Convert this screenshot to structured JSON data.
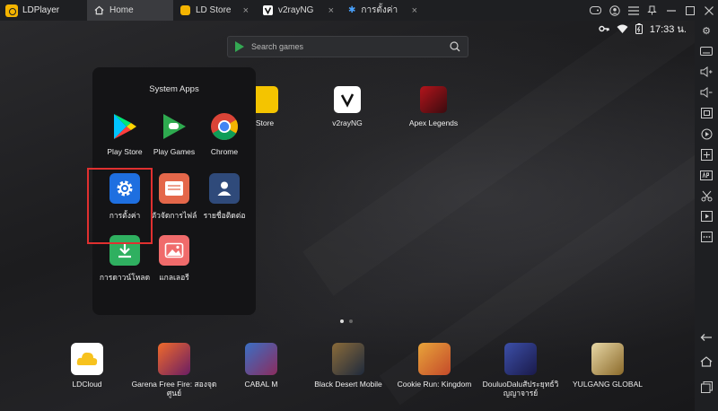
{
  "app": {
    "title": "LDPlayer"
  },
  "tabs": [
    {
      "label": "Home",
      "icon": "home-icon"
    },
    {
      "label": "LD Store",
      "icon": "ld-store-icon",
      "color": "#f4b400"
    },
    {
      "label": "v2rayNG",
      "icon": "v2rayng-icon",
      "color": "#ffffff"
    },
    {
      "label": "การตั้งค่า",
      "icon": "settings-gear-icon",
      "color": "#4aa3ff"
    }
  ],
  "status": {
    "time": "17:33 น."
  },
  "search": {
    "placeholder": "Search games"
  },
  "desktop_apps": [
    {
      "label": "Store"
    },
    {
      "label": "v2rayNG"
    },
    {
      "label": "Apex Legends"
    }
  ],
  "folder": {
    "title": "System Apps",
    "apps": [
      {
        "label": "Play Store",
        "icon": "play-store-icon"
      },
      {
        "label": "Play Games",
        "icon": "play-games-icon"
      },
      {
        "label": "Chrome",
        "icon": "chrome-icon"
      },
      {
        "label": "การตั้งค่า",
        "icon": "settings-icon"
      },
      {
        "label": "ตัวจัดการไฟล์",
        "icon": "file-manager-icon"
      },
      {
        "label": "รายชื่อติดต่อ",
        "icon": "contacts-icon"
      },
      {
        "label": "การดาวน์โหลด",
        "icon": "downloads-icon"
      },
      {
        "label": "แกลเลอรี",
        "icon": "gallery-icon"
      }
    ]
  },
  "dock": [
    {
      "label": "LDCloud"
    },
    {
      "label": "Garena Free Fire: สองจุดศูนย์"
    },
    {
      "label": "CABAL M"
    },
    {
      "label": "Black Desert Mobile"
    },
    {
      "label": "Cookie Run: Kingdom"
    },
    {
      "label": "DouluoDaluสัประยุทธ์วิญญาจารย์"
    },
    {
      "label": "YULGANG GLOBAL"
    }
  ],
  "pager": {
    "pages": 2,
    "current": 1
  },
  "colors": {
    "highlight": "#e03030",
    "brand": "#f4b400",
    "settings_blue": "#1e6fe0"
  }
}
